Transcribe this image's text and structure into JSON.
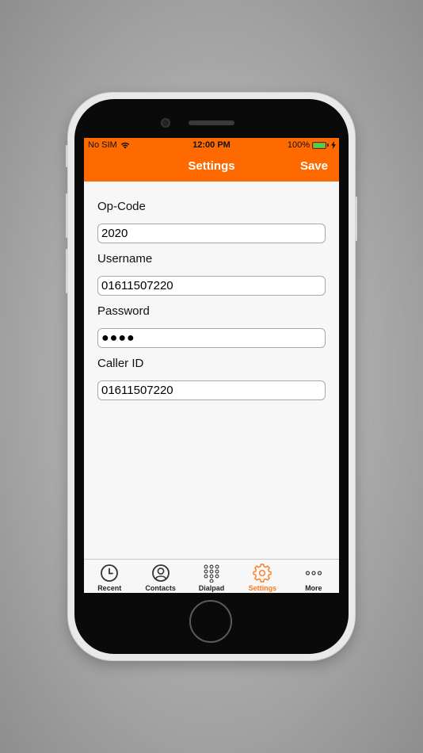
{
  "status_bar": {
    "carrier": "No SIM",
    "time": "12:00 PM",
    "battery": "100%"
  },
  "nav": {
    "title": "Settings",
    "save_label": "Save"
  },
  "form": {
    "fields": [
      {
        "label": "Op-Code",
        "value": "2020"
      },
      {
        "label": "Username",
        "value": "01611507220"
      },
      {
        "label": "Password",
        "value": "●●●●"
      },
      {
        "label": "Caller ID",
        "value": "01611507220"
      }
    ]
  },
  "tabs": [
    {
      "label": "Recent",
      "icon": "clock-icon"
    },
    {
      "label": "Contacts",
      "icon": "contact-icon"
    },
    {
      "label": "Dialpad",
      "icon": "dialpad-icon"
    },
    {
      "label": "Settings",
      "icon": "gear-icon",
      "active": true
    },
    {
      "label": "More",
      "icon": "more-dots-icon"
    }
  ],
  "colors": {
    "accent": "#ff6a00",
    "active_tab": "#ff7a1a",
    "battery": "#2ee04a"
  }
}
